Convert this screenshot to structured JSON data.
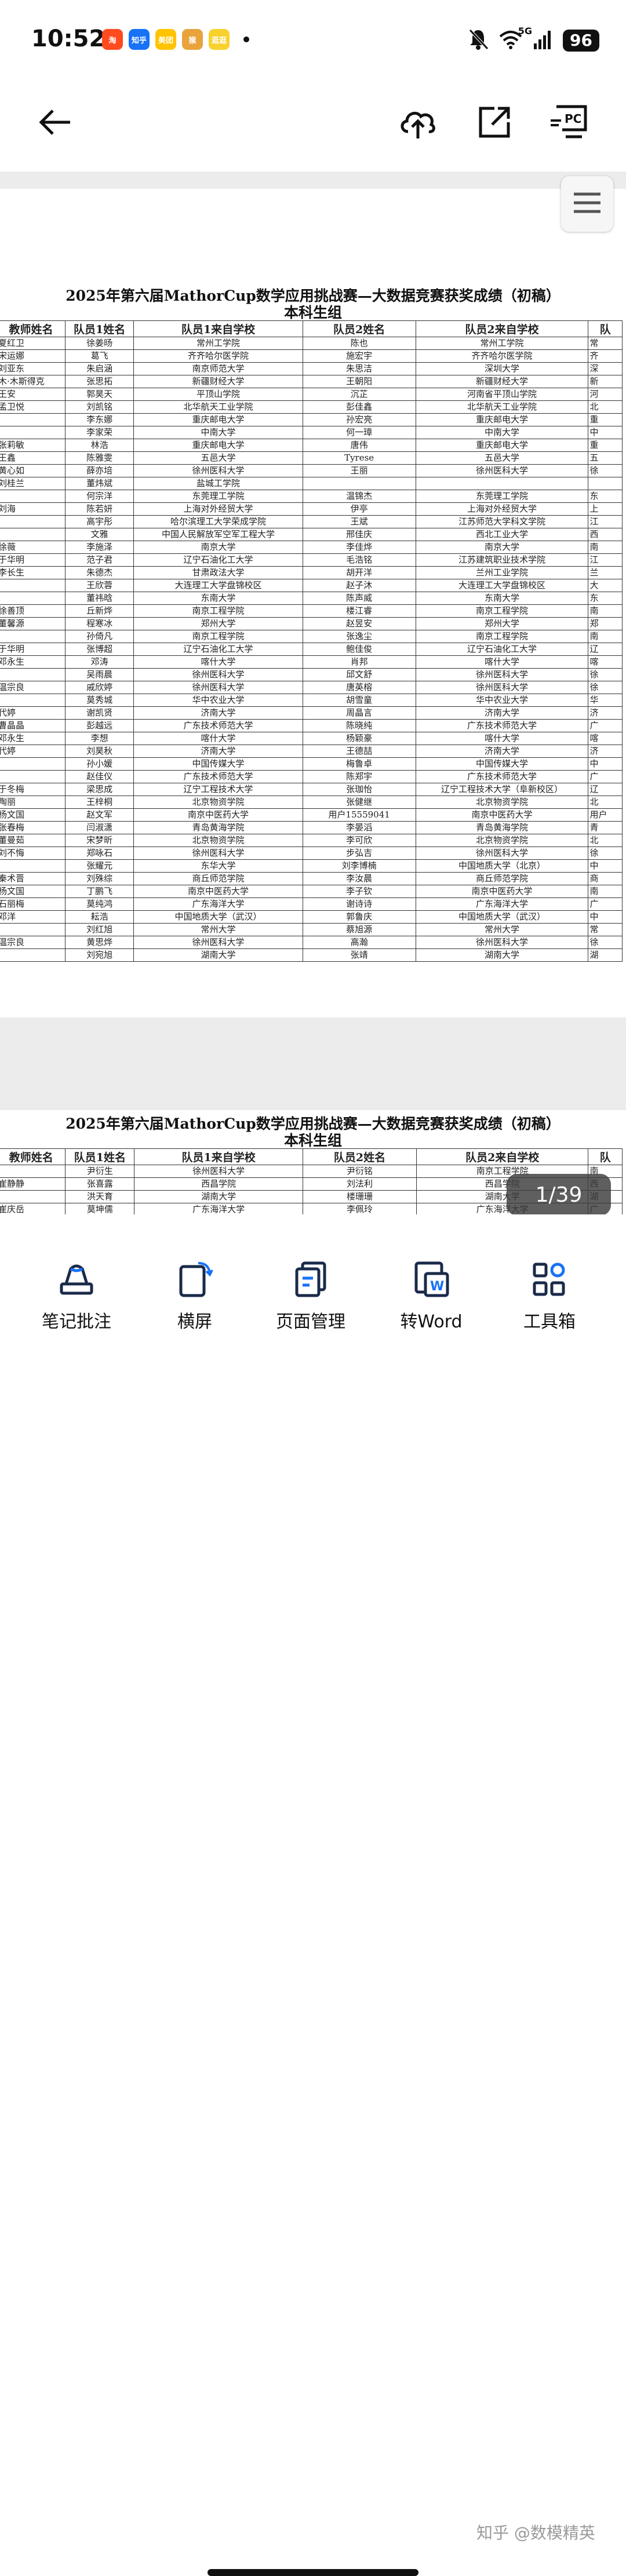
{
  "status_bar": {
    "time": "10:52",
    "apps": [
      {
        "name": "taobao",
        "label": "淘",
        "color": "#ff4b1f"
      },
      {
        "name": "zhihu",
        "label": "知乎",
        "color": "#1772f6"
      },
      {
        "name": "meituan",
        "label": "美团",
        "color": "#ffc300"
      },
      {
        "name": "monkey-app",
        "label": "猴",
        "color": "#e8a33c"
      },
      {
        "name": "keep-app",
        "label": "逛逛",
        "color": "#f8d12e"
      }
    ],
    "network": "5G",
    "battery": "96"
  },
  "toolbar": {
    "back": "back-arrow-icon",
    "upload": "cloud-upload-icon",
    "share": "share-icon",
    "cast": "cast-to-pc-icon",
    "cast_label": "PC"
  },
  "document": {
    "title": "2025年第六届MathorCup数学应用挑战赛—大数据竞赛获奖成绩（初稿）",
    "subtitle": "本科生组",
    "headers": [
      "教师姓名",
      "队员1姓名",
      "队员1来自学校",
      "队员2姓名",
      "队员2来自学校",
      "队"
    ],
    "page1_rows": [
      [
        "夏红卫",
        "徐姜旸",
        "常州工学院",
        "陈也",
        "常州工学院",
        "常"
      ],
      [
        "宋运娜",
        "葛飞",
        "齐齐哈尔医学院",
        "施宏宇",
        "齐齐哈尔医学院",
        "齐"
      ],
      [
        "刘亚东",
        "朱启涵",
        "南京师范大学",
        "朱思洁",
        "深圳大学",
        "深"
      ],
      [
        "木·木斯得克",
        "张思拓",
        "新疆财经大学",
        "王朝阳",
        "新疆财经大学",
        "新"
      ],
      [
        "王安",
        "郭昊天",
        "平顶山学院",
        "沉芷",
        "河南省平顶山学院",
        "河"
      ],
      [
        "孟卫悦",
        "刘凯铭",
        "北华航天工业学院",
        "彭佳鑫",
        "北华航天工业学院",
        "北"
      ],
      [
        "",
        "李东娜",
        "重庆邮电大学",
        "孙宏亮",
        "重庆邮电大学",
        "重"
      ],
      [
        "",
        "李家荣",
        "中南大学",
        "何一璋",
        "中南大学",
        "中"
      ],
      [
        "张莉敏",
        "林浩",
        "重庆邮电大学",
        "唐伟",
        "重庆邮电大学",
        "重"
      ],
      [
        "王鑫",
        "陈雅雯",
        "五邑大学",
        "Tyrese",
        "五邑大学",
        "五"
      ],
      [
        "黄心如",
        "薛亦培",
        "徐州医科大学",
        "王丽",
        "徐州医科大学",
        "徐"
      ],
      [
        "刘桂兰",
        "董炜斌",
        "盐城工学院",
        "",
        "",
        ""
      ],
      [
        "",
        "何宗洋",
        "东莞理工学院",
        "温锦杰",
        "东莞理工学院",
        "东"
      ],
      [
        "刘海",
        "陈若妍",
        "上海对外经贸大学",
        "伊亭",
        "上海对外经贸大学",
        "上"
      ],
      [
        "",
        "高宇彤",
        "哈尔滨理工大学荣成学院",
        "王斌",
        "江苏师范大学科文学院",
        "江"
      ],
      [
        "",
        "文雅",
        "中国人民解放军空军工程大学",
        "邢佳庆",
        "西北工业大学",
        "西"
      ],
      [
        "徐薇",
        "李施泽",
        "南京大学",
        "李佳烨",
        "南京大学",
        "南"
      ],
      [
        "于华明",
        "范子君",
        "辽宁石油化工大学",
        "毛浩铭",
        "江苏建筑职业技术学院",
        "江"
      ],
      [
        "李长生",
        "朱德杰",
        "甘肃政法大学",
        "胡开洋",
        "兰州工业学院",
        "兰"
      ],
      [
        "",
        "王欣蓉",
        "大连理工大学盘锦校区",
        "赵子沐",
        "大连理工大学盘锦校区",
        "大"
      ],
      [
        "",
        "董祎晗",
        "东南大学",
        "陈声威",
        "东南大学",
        "东"
      ],
      [
        "徐善顶",
        "丘新烨",
        "南京工程学院",
        "楼江睿",
        "南京工程学院",
        "南"
      ],
      [
        "董馨源",
        "程寒冰",
        "郑州大学",
        "赵昱安",
        "郑州大学",
        "郑"
      ],
      [
        "",
        "孙倚凡",
        "南京工程学院",
        "张逸尘",
        "南京工程学院",
        "南"
      ],
      [
        "于华明",
        "张博超",
        "辽宁石油化工大学",
        "鲍佳俊",
        "辽宁石油化工大学",
        "辽"
      ],
      [
        "邓永生",
        "邓涛",
        "喀什大学",
        "肖邦",
        "喀什大学",
        "喀"
      ],
      [
        "",
        "吴雨晨",
        "徐州医科大学",
        "邱文舒",
        "徐州医科大学",
        "徐"
      ],
      [
        "温宗良",
        "戚欣婷",
        "徐州医科大学",
        "唐英榕",
        "徐州医科大学",
        "徐"
      ],
      [
        "",
        "莫秀城",
        "华中农业大学",
        "胡雪童",
        "华中农业大学",
        "华"
      ],
      [
        "代婷",
        "谢凯贤",
        "济南大学",
        "周晶言",
        "济南大学",
        "济"
      ],
      [
        "曹晶晶",
        "彭越远",
        "广东技术师范大学",
        "陈晓纯",
        "广东技术师范大学",
        "广"
      ],
      [
        "邓永生",
        "李想",
        "喀什大学",
        "杨颖豪",
        "喀什大学",
        "喀"
      ],
      [
        "代婷",
        "刘昊秋",
        "济南大学",
        "王德喆",
        "济南大学",
        "济"
      ],
      [
        "",
        "孙小媛",
        "中国传媒大学",
        "梅鲁卓",
        "中国传媒大学",
        "中"
      ],
      [
        "",
        "赵佳仪",
        "广东技术师范大学",
        "陈郑宇",
        "广东技术师范大学",
        "广"
      ],
      [
        "于冬梅",
        "梁思成",
        "辽宁工程技术大学",
        "张珈怡",
        "辽宁工程技术大学（阜新校区）",
        "辽"
      ],
      [
        "陶丽",
        "王梓桐",
        "北京物资学院",
        "张健继",
        "北京物资学院",
        "北"
      ],
      [
        "杨文国",
        "赵文军",
        "南京中医药大学",
        "用户15559041",
        "南京中医药大学",
        "用户"
      ],
      [
        "张春梅",
        "闫淑潇",
        "青岛黄海学院",
        "李晏滔",
        "青岛黄海学院",
        "青"
      ],
      [
        "董曼茹",
        "宋梦昕",
        "北京物资学院",
        "李可欣",
        "北京物资学院",
        "北"
      ],
      [
        "刘不悔",
        "郑咏石",
        "徐州医科大学",
        "步弘吉",
        "徐州医科大学",
        "徐"
      ],
      [
        "",
        "张耀元",
        "东华大学",
        "刘李博楠",
        "中国地质大学（北京）",
        "中"
      ],
      [
        "秦术晋",
        "刘殊综",
        "商丘师范学院",
        "李汝晨",
        "商丘师范学院",
        "商"
      ],
      [
        "杨文国",
        "丁鹏飞",
        "南京中医药大学",
        "李子钦",
        "南京中医药大学",
        "南"
      ],
      [
        "石丽梅",
        "莫纯鸿",
        "广东海洋大学",
        "谢诗诗",
        "广东海洋大学",
        "广"
      ],
      [
        "邓洋",
        "耘浩",
        "中国地质大学（武汉）",
        "郭鲁庆",
        "中国地质大学（武汉）",
        "中"
      ],
      [
        "",
        "刘红旭",
        "常州大学",
        "蔡旭源",
        "常州大学",
        "常"
      ],
      [
        "温宗良",
        "黄思烨",
        "徐州医科大学",
        "高瀚",
        "徐州医科大学",
        "徐"
      ],
      [
        "",
        "刘宛旭",
        "湖南大学",
        "张靖",
        "湖南大学",
        "湖"
      ]
    ],
    "page2_rows": [
      [
        "",
        "尹衍生",
        "徐州医科大学",
        "尹衍铭",
        "南京工程学院",
        "南"
      ],
      [
        "崔静静",
        "张喜露",
        "西昌学院",
        "刘法利",
        "西昌学院",
        "西"
      ],
      [
        "",
        "洪天育",
        "湖南大学",
        "楼珊珊",
        "湖南大学",
        "湖"
      ],
      [
        "崔庆岳",
        "莫坤儒",
        "广东海洋大学",
        "李佩玲",
        "广东海洋大学",
        "广"
      ],
      [
        "张闯",
        "肖文杰",
        "北京邮电大学",
        "郭嘉炜",
        "北京邮电大学",
        "北"
      ],
      [
        "胡寒",
        "徐靖涵",
        "南京大学",
        "杨子彤",
        "南京大学",
        "南"
      ]
    ]
  },
  "viewer": {
    "menu": "hamburger-menu-icon",
    "page_indicator": "1/39"
  },
  "bottom_bar": {
    "items": [
      {
        "label": "笔记批注",
        "icon": "annotate-icon"
      },
      {
        "label": "横屏",
        "icon": "rotate-screen-icon"
      },
      {
        "label": "页面管理",
        "icon": "page-manage-icon"
      },
      {
        "label": "转Word",
        "icon": "convert-word-icon"
      },
      {
        "label": "工具箱",
        "icon": "toolbox-icon"
      }
    ],
    "watermark": "知乎 @数模精英"
  },
  "colors": {
    "accent": "#1772f6",
    "text": "#111111",
    "viewer_bg": "#ececec"
  }
}
